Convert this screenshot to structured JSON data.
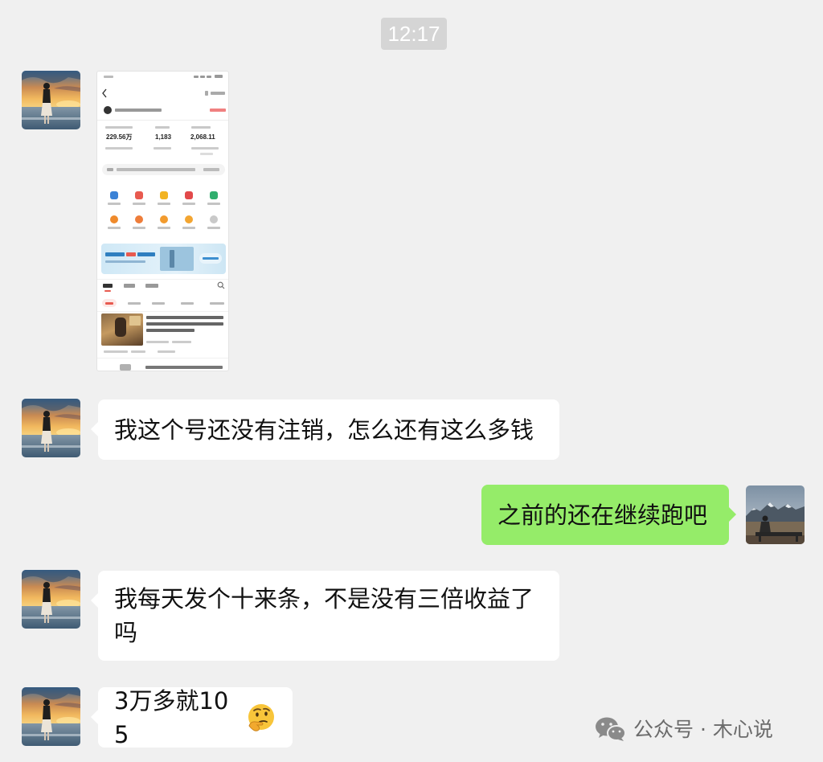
{
  "chat": {
    "timestamp": "12:17",
    "messages": [
      {
        "avatar_icon": "sunset-avatar-icon",
        "image": {
          "stats": [
            "229.56万",
            "1,183",
            "2,068.11"
          ]
        }
      },
      {
        "avatar_icon": "sunset-avatar-icon",
        "text": "我这个号还没有注销，怎么还有这么多钱"
      },
      {
        "avatar_icon": "mountain-avatar-icon",
        "text": "之前的还在继续跑吧"
      },
      {
        "avatar_icon": "sunset-avatar-icon",
        "text": "我每天发个十来条，不是没有三倍收益了吗"
      },
      {
        "avatar_icon": "sunset-avatar-icon",
        "text": "3万多就105",
        "emoji_icon": "thinking-face-icon"
      }
    ]
  },
  "watermark": {
    "icon": "wechat-logo-icon",
    "text": "公众号 · 木心说"
  },
  "colors": {
    "background": "#f0f0f0",
    "bubble_incoming": "#ffffff",
    "bubble_outgoing": "#95ec69",
    "timestamp_bg": "#d5d5d5",
    "watermark_text": "#6b6b6b"
  }
}
